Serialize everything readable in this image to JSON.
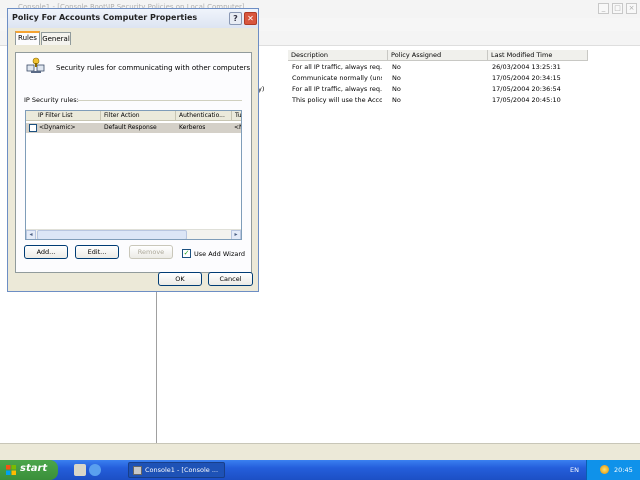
{
  "console": {
    "title": "Console1 - [Console Root\\IP Security Policies on Local Computer]",
    "columns": [
      "Description",
      "Policy Assigned",
      "Last Modified Time"
    ],
    "rows": [
      {
        "name_suffix": "",
        "description": "For all IP traffic, always req...",
        "assigned": "No",
        "modified": "26/03/2004 13:25:31"
      },
      {
        "name_suffix": "",
        "description": "Communicate normally (uns...",
        "assigned": "No",
        "modified": "17/05/2004 20:34:15"
      },
      {
        "name_suffix": "y)",
        "description": "For all IP traffic, always req...",
        "assigned": "No",
        "modified": "17/05/2004 20:36:54"
      },
      {
        "name_suffix": "",
        "description": "This policy will use the Acco...",
        "assigned": "No",
        "modified": "17/05/2004 20:45:10"
      }
    ]
  },
  "dialog": {
    "title": "Policy For Accounts Computer Properties",
    "help_label": "?",
    "close_label": "✕",
    "tabs": [
      "Rules",
      "General"
    ],
    "intro_text": "Security rules for communicating with other computers",
    "group_label": "IP Security rules:",
    "rules_columns": [
      "IP Filter List",
      "Filter Action",
      "Authenticatio...",
      "Tu"
    ],
    "rules": [
      {
        "filter_list": "<Dynamic>",
        "filter_action": "Default Response",
        "authentication": "Kerberos",
        "tunnel": "<N"
      }
    ],
    "scroll_left": "◂",
    "scroll_right": "▸",
    "buttons": {
      "add": "Add...",
      "edit": "Edit...",
      "remove": "Remove"
    },
    "use_wizard_label": "Use Add Wizard",
    "use_wizard_mark": "✓",
    "ok": "OK",
    "cancel": "Cancel"
  },
  "taskbar": {
    "start": "start",
    "task_label": "Console1 - [Console ...",
    "language": "EN",
    "clock": "20:45"
  },
  "colors": {
    "taskbar_blue": "#245edb",
    "start_green": "#3a8f3a",
    "close_red": "#d8563e",
    "dialog_face": "#ece9d8",
    "selection_gray": "#d4d0c8"
  }
}
